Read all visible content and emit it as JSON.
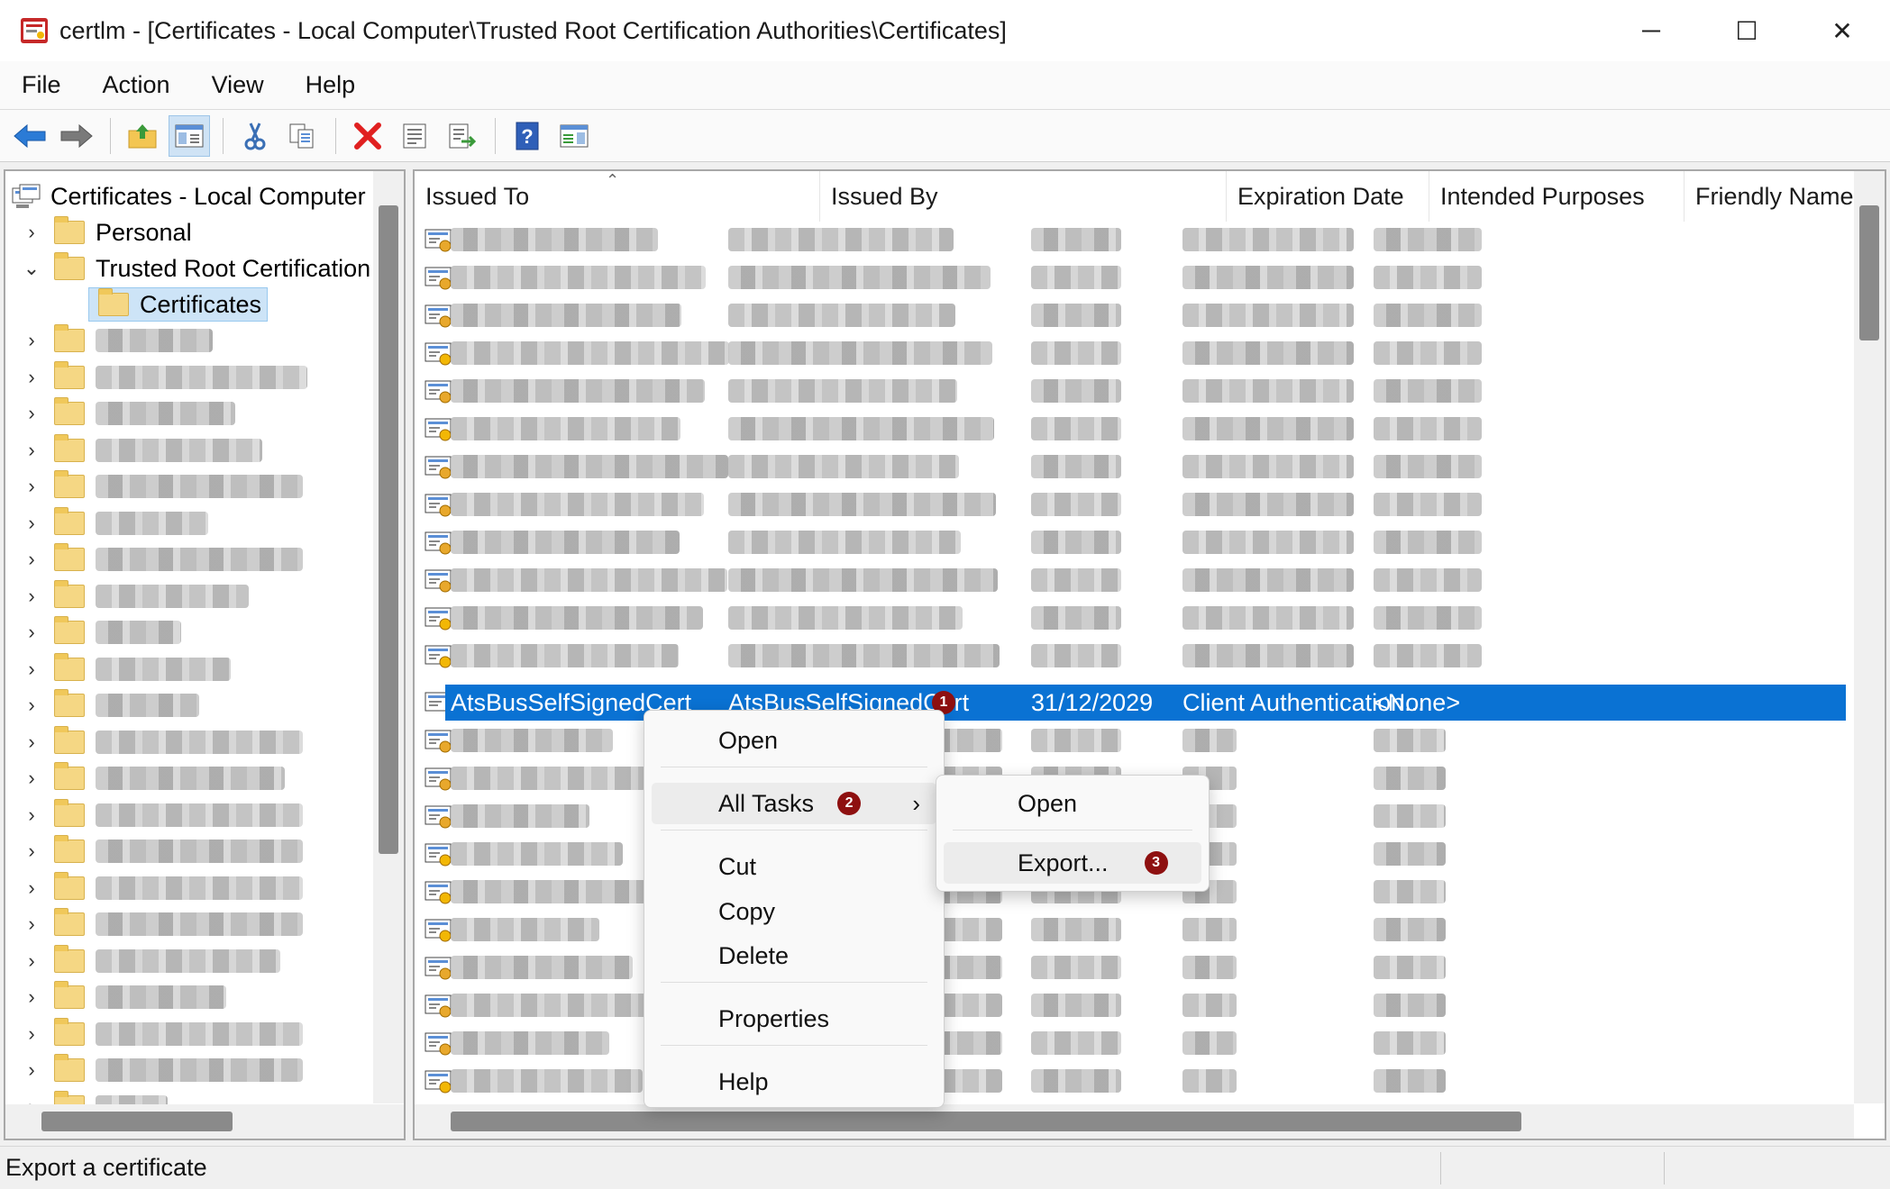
{
  "window": {
    "title": "certlm - [Certificates - Local Computer\\Trusted Root Certification Authorities\\Certificates]",
    "controls": [
      "─",
      "☐",
      "✕"
    ]
  },
  "menu": [
    "File",
    "Action",
    "View",
    "Help"
  ],
  "toolbar": {
    "icons": [
      "back-arrow-icon",
      "forward-arrow-icon",
      "up-folder-icon",
      "show-hide-tree-icon",
      "cut-icon",
      "copy-icon",
      "delete-icon",
      "properties-icon",
      "export-list-icon",
      "help-icon",
      "action-pane-icon"
    ]
  },
  "tree": {
    "root": "Certificates - Local Computer",
    "personal": "Personal",
    "trusted_root": "Trusted Root Certification A",
    "certificates": "Certificates",
    "blurred_count": 22
  },
  "list": {
    "columns": [
      "Issued To",
      "Issued By",
      "Expiration Date",
      "Intended Purposes",
      "Friendly Name"
    ],
    "selected": {
      "issued_to": "AtsBusSelfSignedCert",
      "issued_by": "AtsBusSelfSignedCert",
      "expiration": "31/12/2029",
      "purposes": "Client Authentication...",
      "friendly": "<None>"
    },
    "partial_text": "V..TTOCA. CADOOT"
  },
  "context_menu": {
    "open": "Open",
    "all_tasks": "All Tasks",
    "cut": "Cut",
    "copy": "Copy",
    "delete": "Delete",
    "properties": "Properties",
    "help": "Help"
  },
  "submenu": {
    "open": "Open",
    "export": "Export..."
  },
  "badges": [
    "1",
    "2",
    "3"
  ],
  "status": "Export a certificate",
  "colors": {
    "selection": "#0a72d3",
    "badge": "#8e1010"
  }
}
